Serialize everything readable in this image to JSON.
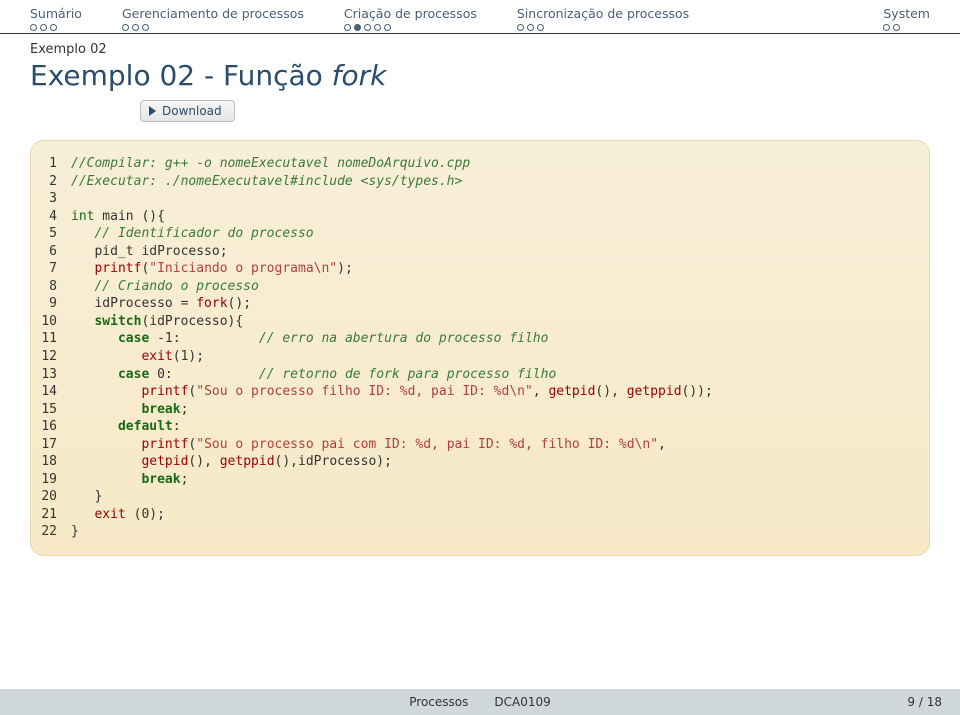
{
  "nav": {
    "sumario": {
      "label": "Sumário",
      "dots": [
        false,
        false,
        false
      ]
    },
    "gerenciamento": {
      "label": "Gerenciamento de processos",
      "dots": [
        false,
        false,
        false
      ]
    },
    "criacao": {
      "label": "Criação de processos",
      "dots": [
        false,
        true,
        false,
        false,
        false
      ]
    },
    "sincronizacao": {
      "label": "Sincronização de processos",
      "dots": [
        false,
        false,
        false
      ]
    },
    "system": {
      "label": "System",
      "dots": [
        false,
        false
      ]
    }
  },
  "subtitle": "Exemplo 02",
  "title_plain": "Exemplo 02 - Função ",
  "title_em": "fork",
  "download": "Download",
  "code": {
    "l1": "//Compilar: g++ -o nomeExecutavel nomeDoArquivo.cpp",
    "l2": "//Executar: ./nomeExecutavel#include <sys/types.h>",
    "l3": "",
    "l4a": "int",
    "l4b": " main (){",
    "l5": "   // Identificador do processo",
    "l6": "   pid_t idProcesso;",
    "l7a": "   ",
    "l7b": "printf",
    "l7c": "(",
    "l7d": "\"Iniciando o programa\\n\"",
    "l7e": ");",
    "l8": "   // Criando o processo",
    "l9a": "   idProcesso = ",
    "l9b": "fork",
    "l9c": "();",
    "l10a": "   ",
    "l10b": "switch",
    "l10c": "(idProcesso){",
    "l11a": "      ",
    "l11b": "case",
    "l11c": " -1:          ",
    "l11d": "// erro na abertura do processo filho",
    "l12a": "         ",
    "l12b": "exit",
    "l12c": "(1);",
    "l13a": "      ",
    "l13b": "case",
    "l13c": " 0:           ",
    "l13d": "// retorno de fork para processo filho",
    "l14a": "         ",
    "l14b": "printf",
    "l14c": "(",
    "l14d": "\"Sou o processo filho ID: %d, pai ID: %d\\n\"",
    "l14e": ", ",
    "l14f": "getpid",
    "l14g": "(), ",
    "l14h": "getppid",
    "l14i": "());",
    "l15a": "         ",
    "l15b": "break",
    "l15c": ";",
    "l16a": "      ",
    "l16b": "default",
    "l16c": ":",
    "l17a": "         ",
    "l17b": "printf",
    "l17c": "(",
    "l17d": "\"Sou o processo pai com ID: %d, pai ID: %d, filho ID: %d\\n\"",
    "l17e": ",",
    "l18a": "         ",
    "l18b": "getpid",
    "l18c": "(), ",
    "l18d": "getppid",
    "l18e": "(),idProcesso);",
    "l19a": "         ",
    "l19b": "break",
    "l19c": ";",
    "l20": "   }",
    "l21a": "   ",
    "l21b": "exit",
    "l21c": " (0);",
    "l22": "}"
  },
  "footer": {
    "left": "Processos",
    "mid": "DCA0109",
    "page": "9 / 18"
  }
}
